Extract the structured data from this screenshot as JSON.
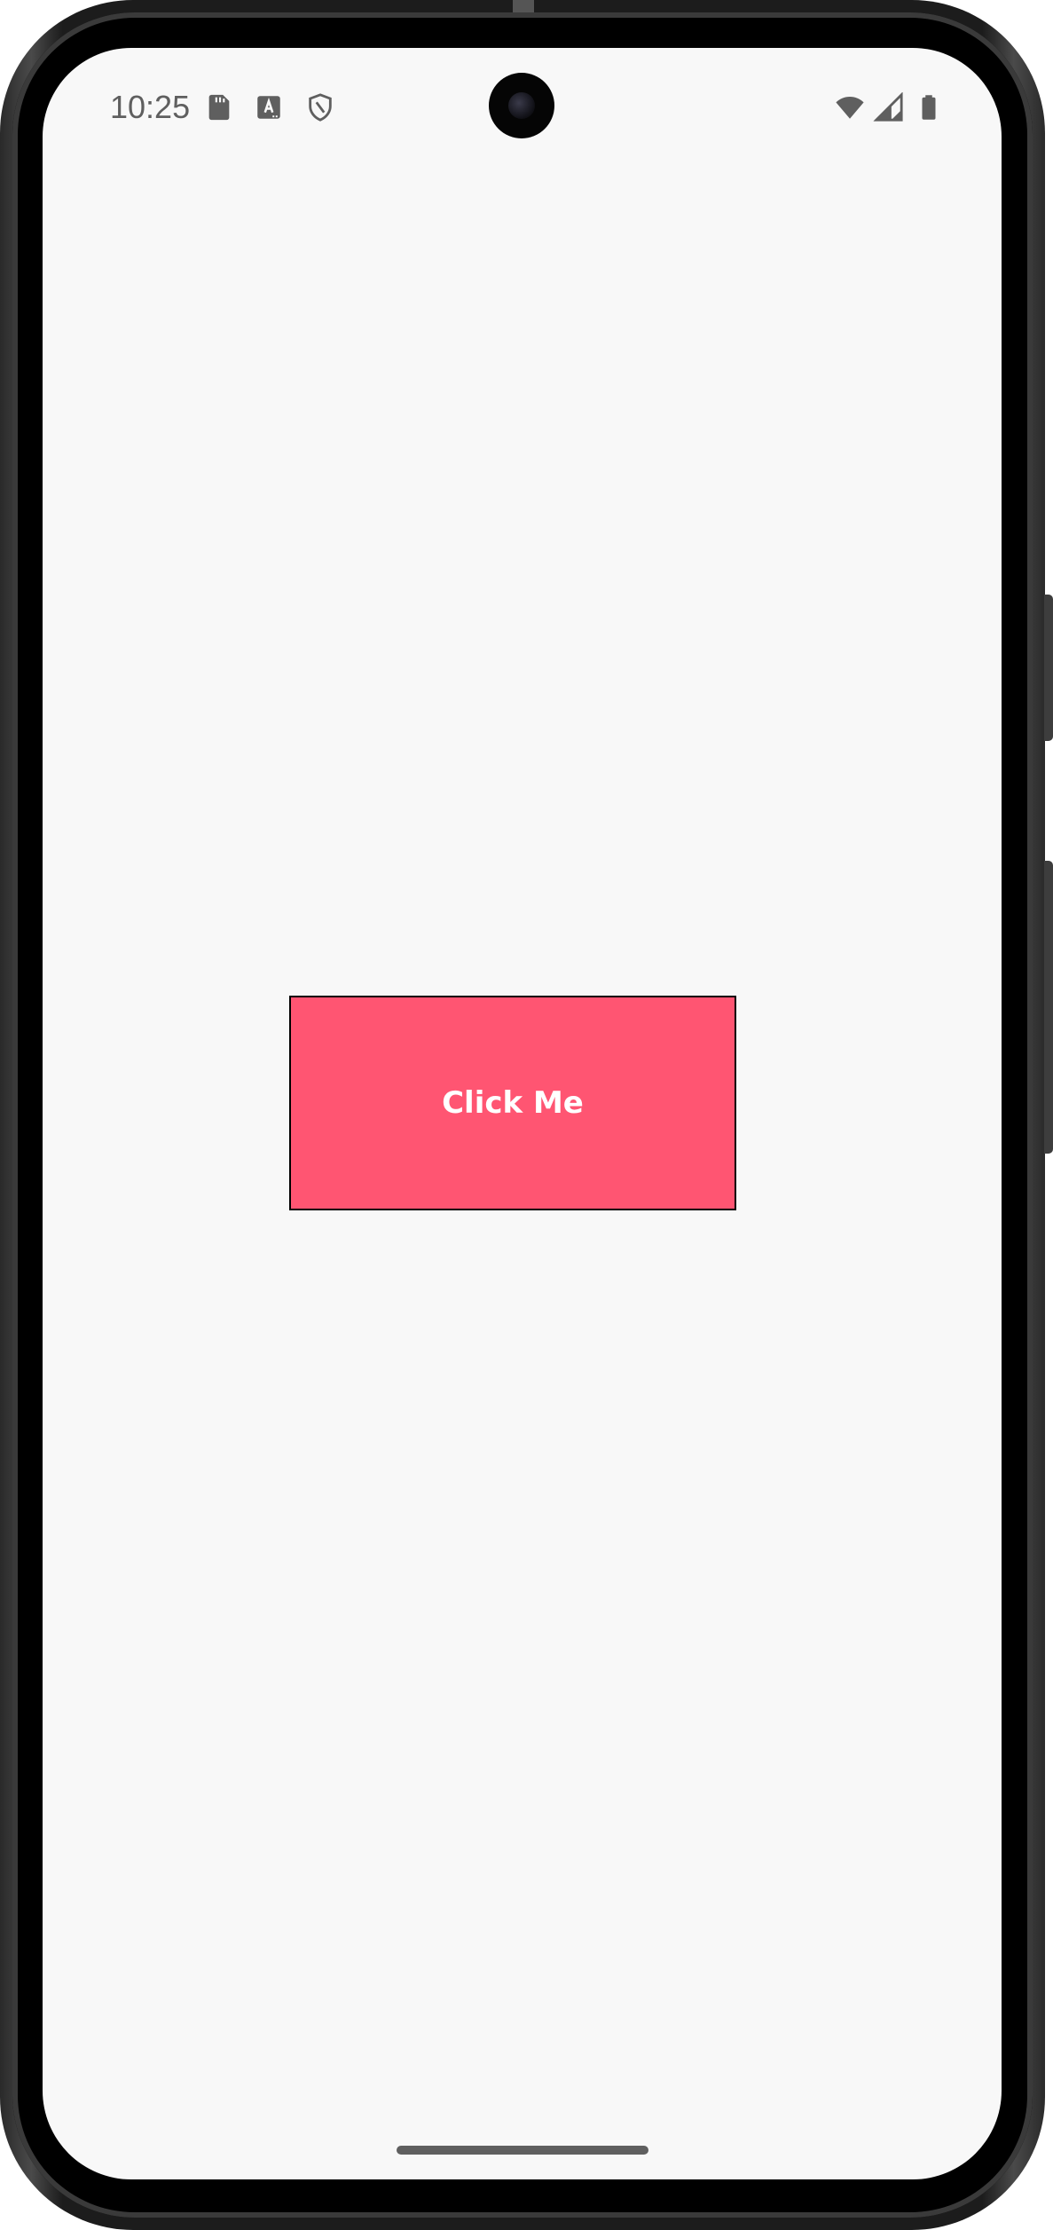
{
  "status_bar": {
    "time": "10:25",
    "icons_left": [
      "sd-card-icon",
      "text-a-icon",
      "shield-icon"
    ],
    "icons_right": [
      "wifi-icon",
      "cellular-signal-icon",
      "battery-icon"
    ]
  },
  "main": {
    "button_label": "Click Me"
  },
  "colors": {
    "button_fill": "#ff5572",
    "button_border": "#000000",
    "button_text": "#ffffff",
    "screen_background": "#f8f8f8",
    "status_icons": "#5f5f5f"
  }
}
